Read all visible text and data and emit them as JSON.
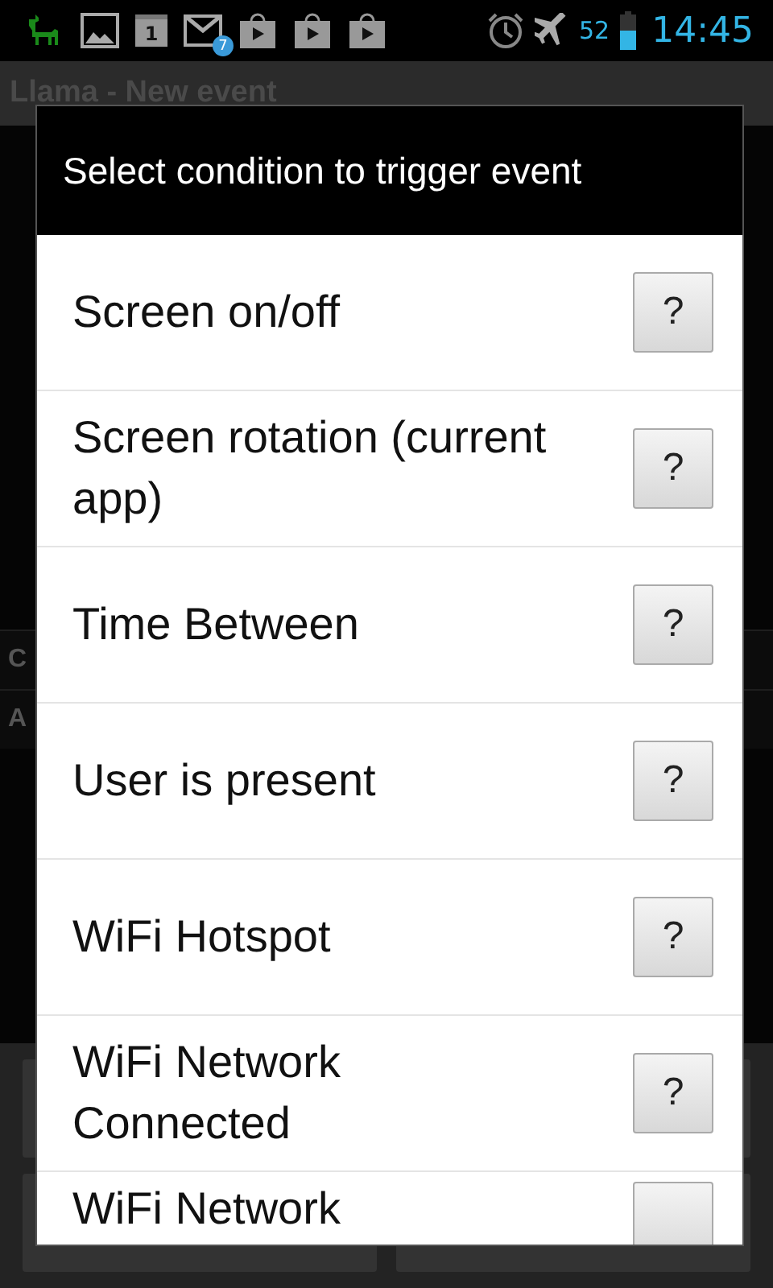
{
  "status_bar": {
    "battery_percent": "52",
    "time": "14:45",
    "mail_badge": "7",
    "calendar_day": "1"
  },
  "app": {
    "title": "Llama - New event",
    "rows": [
      "C",
      "A"
    ]
  },
  "dialog": {
    "title": "Select condition to trigger event",
    "items": [
      {
        "label": "Screen on/off",
        "help": "?"
      },
      {
        "label": "Screen rotation (current app)",
        "help": "?"
      },
      {
        "label": "Time Between",
        "help": "?"
      },
      {
        "label": "User is present",
        "help": "?"
      },
      {
        "label": "WiFi Hotspot",
        "help": "?"
      },
      {
        "label": "WiFi Network Connected",
        "help": "?"
      },
      {
        "label": "WiFi Network"
      }
    ]
  }
}
